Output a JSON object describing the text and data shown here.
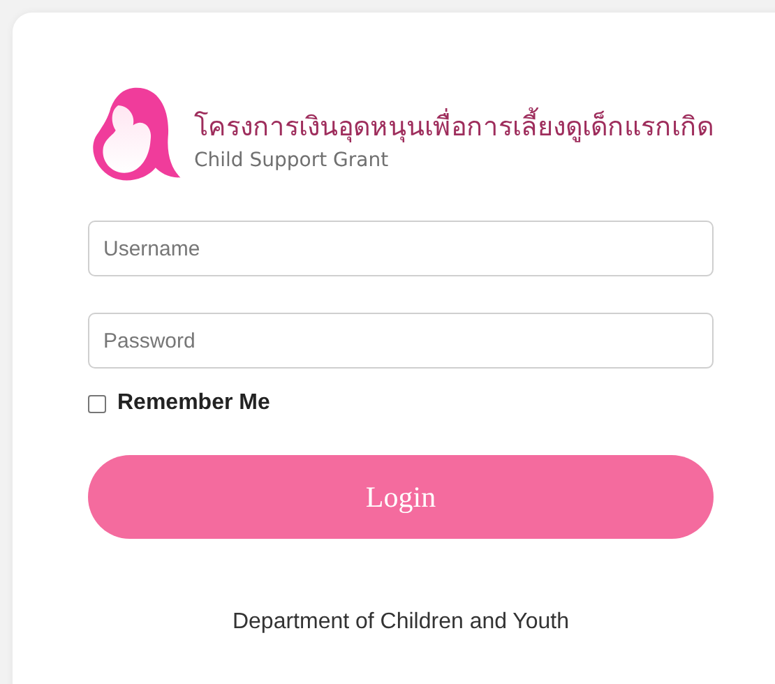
{
  "brand": {
    "title": "โครงการเงินอุดหนุนเพื่อการเลี้ยงดูเด็กแรกเกิด",
    "subtitle": "Child Support Grant"
  },
  "username": {
    "placeholder": "Username"
  },
  "password": {
    "placeholder": "Password"
  },
  "remember": {
    "label": "Remember Me",
    "checked": false
  },
  "login_button": {
    "label": "Login"
  },
  "footer": "Department of Children and Youth"
}
